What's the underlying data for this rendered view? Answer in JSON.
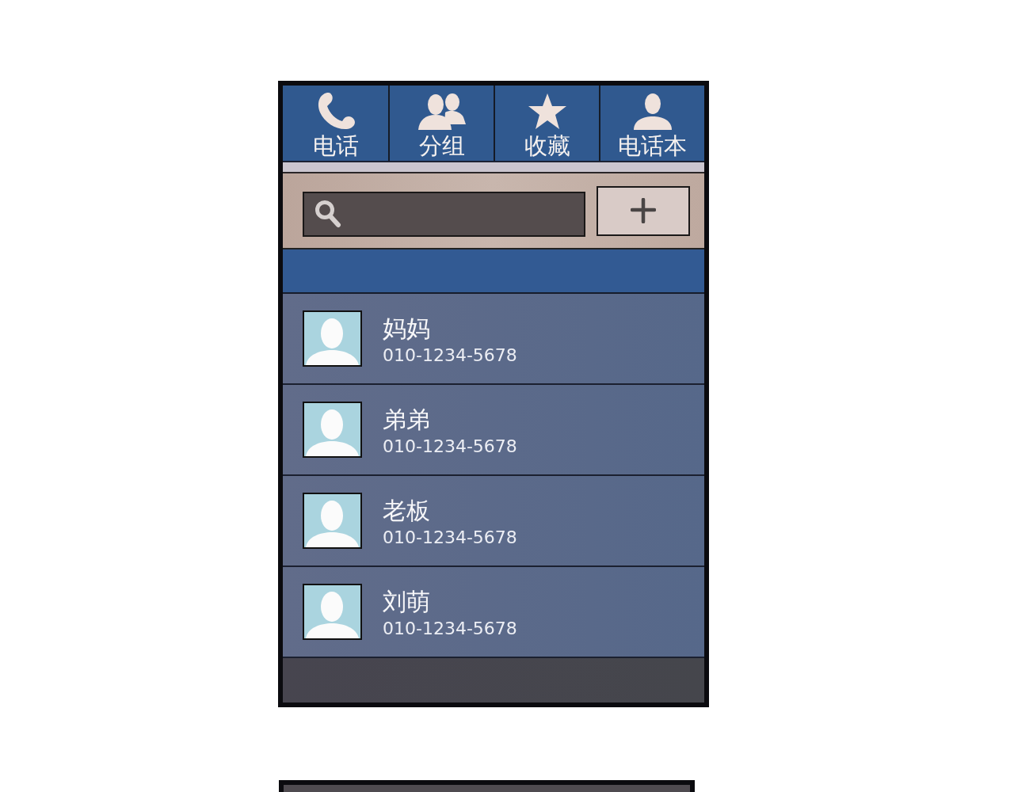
{
  "tabs": [
    {
      "label": "电话",
      "kind": "phone"
    },
    {
      "label": "分组",
      "kind": "group"
    },
    {
      "label": "收藏",
      "kind": "star"
    },
    {
      "label": "电话本",
      "kind": "person"
    }
  ],
  "contacts": [
    {
      "name": "妈妈",
      "phone": "010-1234-5678"
    },
    {
      "name": "弟弟",
      "phone": "010-1234-5678"
    },
    {
      "name": "老板",
      "phone": "010-1234-5678"
    },
    {
      "name": "刘萌",
      "phone": "010-1234-5678"
    }
  ]
}
